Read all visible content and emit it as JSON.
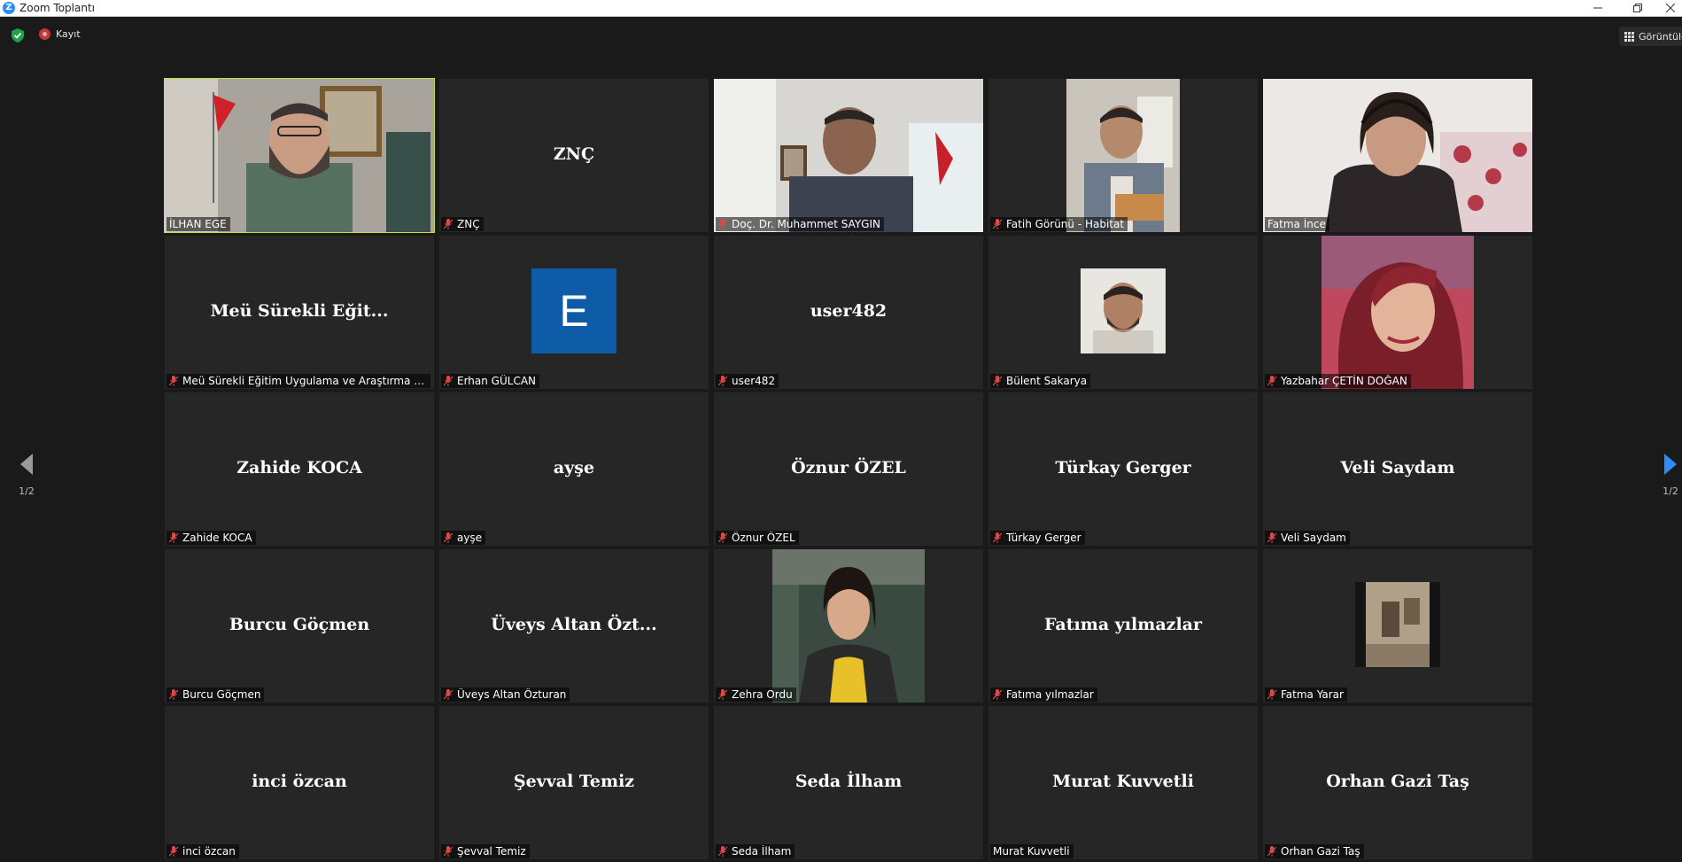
{
  "window": {
    "title": "Zoom Toplantı",
    "logo_letter": "Z"
  },
  "toolbar": {
    "recording_label": "Kayıt",
    "view_label": "Görüntüle"
  },
  "pagination": {
    "left": "1/2",
    "right": "1/2"
  },
  "colors": {
    "active_speaker": "#c6e03d",
    "background": "#1a1a1a",
    "tile": "#262626",
    "avatar_blue": "#0e5ba8",
    "muted_mic": "#e04848"
  },
  "participants": [
    {
      "display": "",
      "tag": "İLHAN EGE",
      "muted": false,
      "video": true,
      "active": true
    },
    {
      "display": "ZNÇ",
      "tag": "ZNÇ",
      "muted": true,
      "video": false
    },
    {
      "display": "",
      "tag": "Doç. Dr. Muhammet SAYGIN",
      "muted": true,
      "video": true
    },
    {
      "display": "",
      "tag": "Fatih Görünü - Habitat",
      "muted": true,
      "video": true
    },
    {
      "display": "",
      "tag": "Fatma İnce",
      "muted": false,
      "video": true
    },
    {
      "display": "Meü Sürekli Eğit...",
      "tag": "Meü Sürekli Eğitim Uygulama ve Araştırma Me...",
      "muted": true,
      "video": false
    },
    {
      "display": "",
      "tag": "Erhan GÜLCAN",
      "muted": true,
      "video": false,
      "avatar_letter": "E"
    },
    {
      "display": "user482",
      "tag": "user482",
      "muted": true,
      "video": false
    },
    {
      "display": "",
      "tag": "Bülent Sakarya",
      "muted": true,
      "video": false,
      "photo": true
    },
    {
      "display": "",
      "tag": "Yazbahar ÇETİN DOĞAN",
      "muted": true,
      "video": false,
      "photo": true
    },
    {
      "display": "Zahide KOCA",
      "tag": "Zahide KOCA",
      "muted": true,
      "video": false
    },
    {
      "display": "ayşe",
      "tag": "ayşe",
      "muted": true,
      "video": false
    },
    {
      "display": "Öznur ÖZEL",
      "tag": "Öznur ÖZEL",
      "muted": true,
      "video": false
    },
    {
      "display": "Türkay Gerger",
      "tag": "Türkay Gerger",
      "muted": true,
      "video": false
    },
    {
      "display": "Veli Saydam",
      "tag": "Veli Saydam",
      "muted": true,
      "video": false
    },
    {
      "display": "Burcu Göçmen",
      "tag": "Burcu Göçmen",
      "muted": true,
      "video": false
    },
    {
      "display": "Üveys Altan Özt...",
      "tag": "Üveys Altan Özturan",
      "muted": true,
      "video": false
    },
    {
      "display": "",
      "tag": "Zehra Ordu",
      "muted": true,
      "video": false,
      "photo": true
    },
    {
      "display": "Fatıma yılmazlar",
      "tag": "Fatıma yılmazlar",
      "muted": true,
      "video": false
    },
    {
      "display": "",
      "tag": "Fatma Yarar",
      "muted": true,
      "video": false,
      "photo": true
    },
    {
      "display": "inci özcan",
      "tag": "inci özcan",
      "muted": true,
      "video": false
    },
    {
      "display": "Şevval Temiz",
      "tag": "Şevval Temiz",
      "muted": true,
      "video": false
    },
    {
      "display": "Seda İlham",
      "tag": "Seda İlham",
      "muted": true,
      "video": false
    },
    {
      "display": "Murat Kuvvetli",
      "tag": "Murat Kuvvetli",
      "muted": false,
      "video": false
    },
    {
      "display": "Orhan Gazi Taş",
      "tag": "Orhan Gazi Taş",
      "muted": true,
      "video": false
    }
  ]
}
